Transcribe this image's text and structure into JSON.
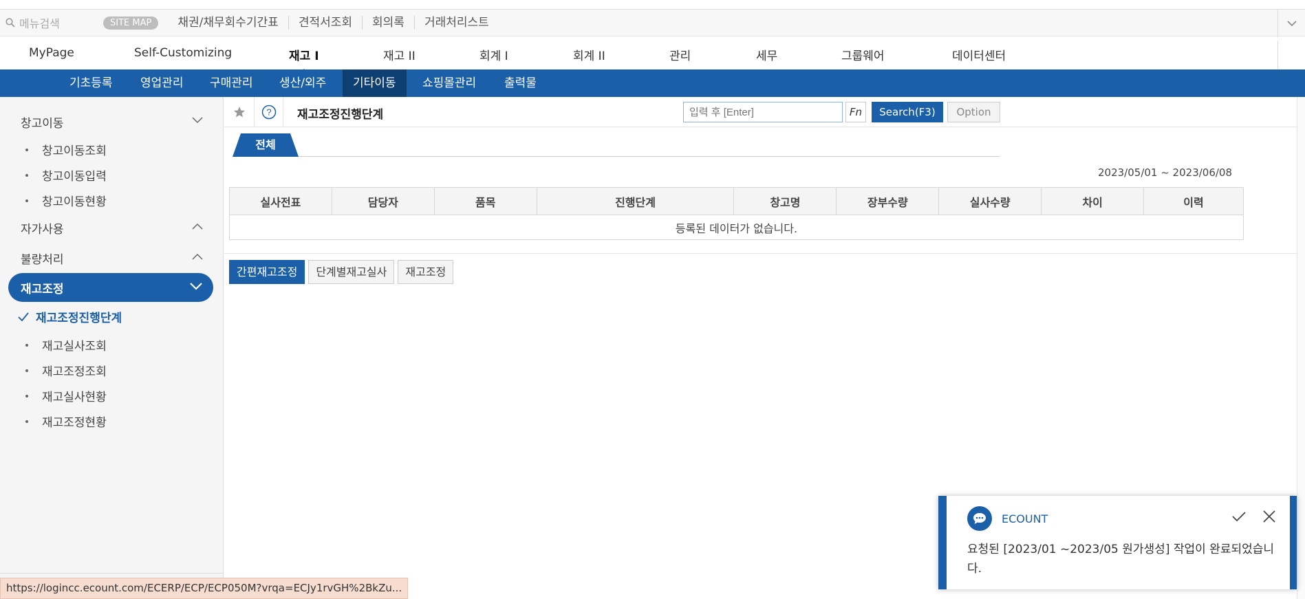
{
  "topbar": {
    "search_placeholder": "메뉴검색",
    "sitemap": "SITE MAP",
    "shortcuts": [
      "채권/채무회수기간표",
      "견적서조회",
      "회의록",
      "거래처리스트"
    ]
  },
  "mainmenu": [
    "MyPage",
    "Self-Customizing",
    "재고 I",
    "재고 II",
    "회계 I",
    "회계 II",
    "관리",
    "세무",
    "그룹웨어",
    "데이터센터"
  ],
  "submenu": [
    "기초등록",
    "영업관리",
    "구매관리",
    "생산/외주",
    "기타이동",
    "쇼핑몰관리",
    "출력물"
  ],
  "sidebar": {
    "group1": "창고이동",
    "group1_items": [
      "창고이동조회",
      "창고이동입력",
      "창고이동현황"
    ],
    "group2": "자가사용",
    "group3": "불량처리",
    "active_group": "재고조정",
    "current_item": "재고조정진행단계",
    "group4_items": [
      "재고실사조회",
      "재고조정조회",
      "재고실사현황",
      "재고조정현황"
    ]
  },
  "content": {
    "title": "재고조정진행단계",
    "search_placeholder": "입력 후 [Enter]",
    "fn_label": "Fn",
    "search_label": "Search(F3)",
    "option_label": "Option",
    "tab_all": "전체",
    "date_range": "2023/05/01 ~ 2023/06/08",
    "columns": [
      "실사전표",
      "담당자",
      "품목",
      "진행단계",
      "창고명",
      "장부수량",
      "실사수량",
      "차이",
      "이력"
    ],
    "empty_message": "등록된 데이터가 없습니다.",
    "bottom_buttons": [
      "간편재고조정",
      "단계별재고실사",
      "재고조정"
    ]
  },
  "notification": {
    "title": "ECOUNT",
    "message": "요청된 [2023/01 ~2023/05 원가생성] 작업이 완료되었습니다."
  },
  "status_url": "https://logincc.ecount.com/ECERP/ECP/ECP050M?vrqa=ECJy1rvGH%2BkZu...",
  "colors": {
    "primary": "#1b5fa8",
    "primary_dark": "#0d3f73"
  },
  "icons": [
    "search-icon",
    "chevron-down-icon",
    "chevron-up-icon",
    "star-icon",
    "help-icon",
    "check-icon",
    "close-icon",
    "chat-icon"
  ]
}
